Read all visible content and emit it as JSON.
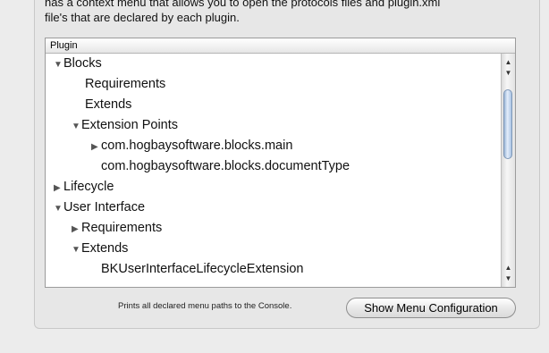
{
  "description": {
    "line1": "has a context menu that allows you to open the protocols files and plugin.xml",
    "line2": "file's that are declared by each plugin."
  },
  "outline": {
    "column_header": "Plugin",
    "rows": [
      {
        "label": "Blocks",
        "expanded": true
      },
      {
        "label": "Requirements"
      },
      {
        "label": "Extends"
      },
      {
        "label": "Extension Points",
        "expanded": true
      },
      {
        "label": "com.hogbaysoftware.blocks.main",
        "expanded": false
      },
      {
        "label": "com.hogbaysoftware.blocks.documentType"
      },
      {
        "label": "Lifecycle",
        "expanded": false
      },
      {
        "label": "User Interface",
        "expanded": true
      },
      {
        "label": "Requirements",
        "expanded": false
      },
      {
        "label": "Extends",
        "expanded": true
      },
      {
        "label": "BKUserInterfaceLifecycleExtension"
      }
    ],
    "triangle_expanded": "▼",
    "triangle_collapsed": "▶"
  },
  "footer": {
    "hint": "Prints all declared menu paths to the Console.",
    "button_label": "Show Menu Configuration"
  },
  "scrollbar": {
    "up_arrow": "▲",
    "down_arrow": "▼"
  }
}
